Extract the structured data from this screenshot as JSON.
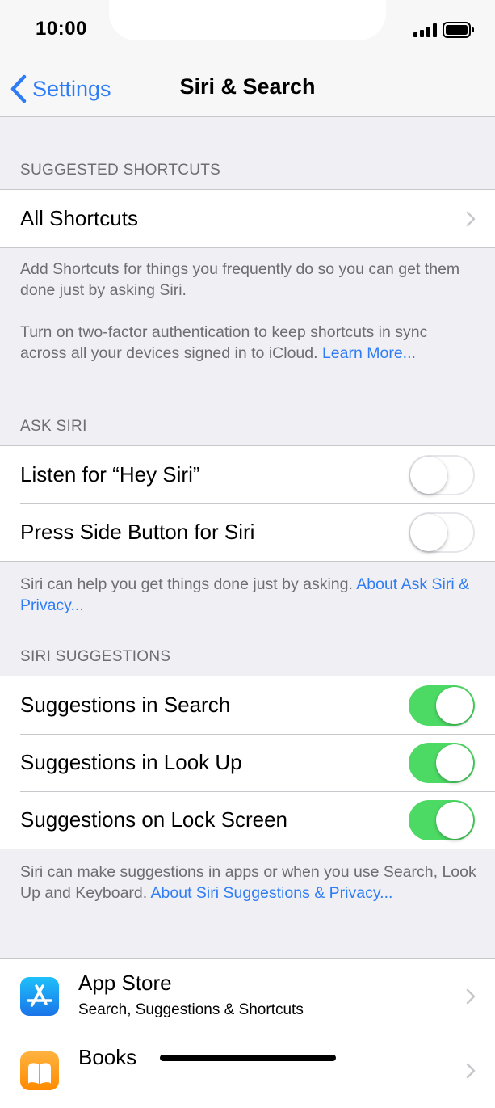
{
  "status_bar": {
    "time": "10:00"
  },
  "nav": {
    "back_label": "Settings",
    "title": "Siri & Search"
  },
  "suggested_shortcuts": {
    "header": "SUGGESTED SHORTCUTS",
    "all_shortcuts_label": "All Shortcuts",
    "footer_p1": "Add Shortcuts for things you frequently do so you can get them done just by asking Siri.",
    "footer_p2_text": "Turn on two-factor authentication to keep shortcuts in sync across all your devices signed in to iCloud.",
    "footer_p2_link": "Learn More..."
  },
  "ask_siri": {
    "header": "ASK SIRI",
    "items": [
      {
        "label": "Listen for “Hey Siri”",
        "on": false
      },
      {
        "label": "Press Side Button for Siri",
        "on": false
      }
    ],
    "footer_text": "Siri can help you get things done just by asking.",
    "footer_link": "About Ask Siri & Privacy..."
  },
  "siri_suggestions": {
    "header": "SIRI SUGGESTIONS",
    "items": [
      {
        "label": "Suggestions in Search",
        "on": true
      },
      {
        "label": "Suggestions in Look Up",
        "on": true
      },
      {
        "label": "Suggestions on Lock Screen",
        "on": true
      }
    ],
    "footer_text": "Siri can make suggestions in apps or when you use Search, Look Up and Keyboard.",
    "footer_link": "About Siri Suggestions & Privacy..."
  },
  "apps": [
    {
      "name": "App Store",
      "subtitle": "Search, Suggestions & Shortcuts",
      "icon": "app-store-icon"
    },
    {
      "name": "Books",
      "subtitle": "",
      "icon": "books-icon"
    }
  ],
  "colors": {
    "accent": "#2f7df6",
    "toggle_on": "#4cd964",
    "background": "#efeff4"
  }
}
